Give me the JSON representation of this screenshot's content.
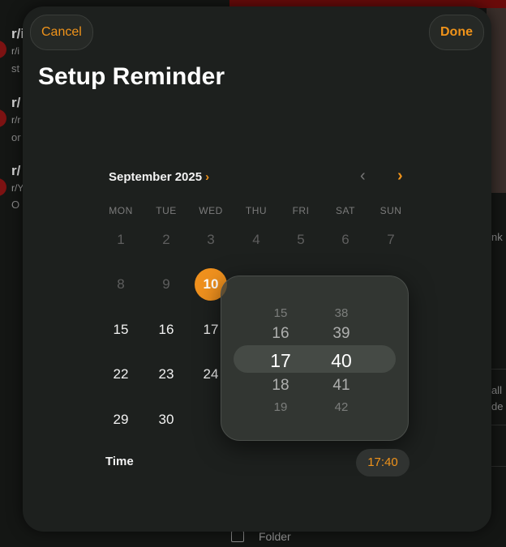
{
  "background": {
    "items": [
      {
        "t1": "r/i",
        "t2": "r/i",
        "t3": "st"
      },
      {
        "t1": "r/",
        "t2": "r/r",
        "t3": "or"
      },
      {
        "t1": "r/",
        "t2": "r/Y",
        "t3": "O"
      }
    ],
    "right_texts": [
      "nk",
      "all",
      "de"
    ],
    "folder_label": "Folder"
  },
  "sheet": {
    "cancel_label": "Cancel",
    "done_label": "Done",
    "title": "Setup Reminder"
  },
  "calendar": {
    "month_label": "September 2025",
    "month_chevron": "›",
    "prev_icon": "‹",
    "next_icon": "›",
    "weekdays": [
      "MON",
      "TUE",
      "WED",
      "THU",
      "FRI",
      "SAT",
      "SUN"
    ],
    "rows": [
      [
        "1",
        "2",
        "3",
        "4",
        "5",
        "6",
        "7"
      ],
      [
        "8",
        "9",
        "10",
        "",
        "",
        "",
        ""
      ],
      [
        "15",
        "16",
        "17",
        "",
        "",
        "",
        ""
      ],
      [
        "22",
        "23",
        "24",
        "",
        "",
        "",
        ""
      ],
      [
        "29",
        "30",
        "",
        "",
        "",
        "",
        ""
      ]
    ],
    "selected_day": "10"
  },
  "time": {
    "label": "Time",
    "value": "17:40"
  },
  "picker": {
    "hours": [
      "15",
      "16",
      "17",
      "18",
      "19"
    ],
    "minutes": [
      "38",
      "39",
      "40",
      "41",
      "42"
    ]
  },
  "colors": {
    "accent": "#f0931a",
    "selected_day_bg": "#f0911e",
    "sheet_bg": "#1d201e"
  }
}
